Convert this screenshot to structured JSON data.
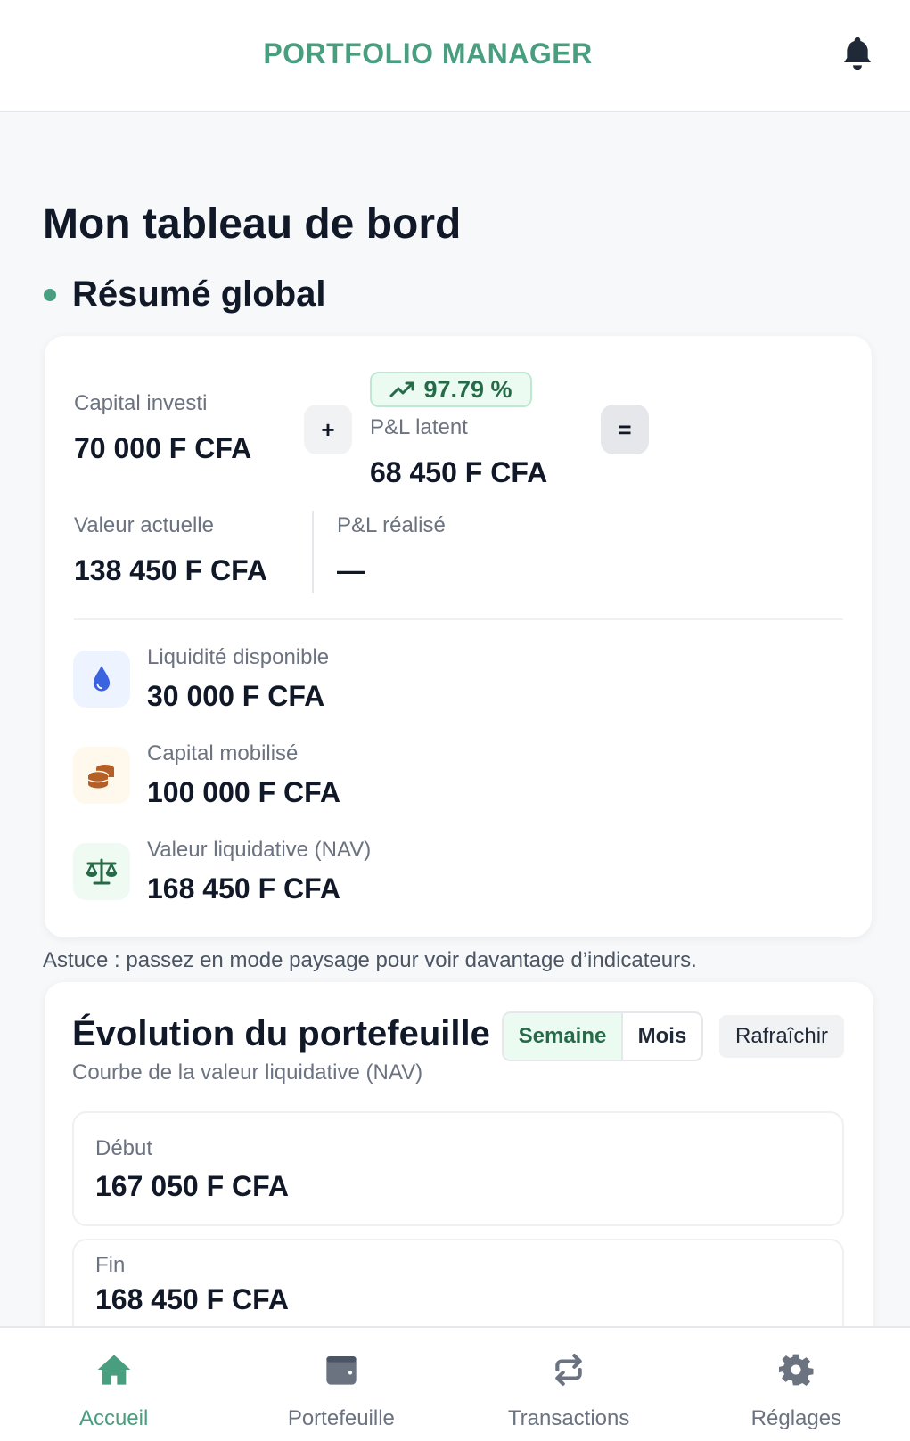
{
  "header": {
    "title": "PORTFOLIO MANAGER",
    "bell_icon": "bell-icon"
  },
  "page_title": "Mon tableau de bord",
  "summary": {
    "title": "Résumé global",
    "capital_investi": {
      "label": "Capital investi",
      "value": "70 000 F CFA"
    },
    "plus": "+",
    "equals": "=",
    "pl_latent": {
      "label": "P&L latent",
      "value": "68 450 F CFA",
      "badge": "97.79 %"
    },
    "valeur_actuelle": {
      "label": "Valeur actuelle",
      "value": "138 450 F CFA"
    },
    "pl_realise": {
      "label": "P&L réalisé",
      "value": "—"
    },
    "items": [
      {
        "label": "Liquidité disponible",
        "value": "30 000 F CFA",
        "icon": "droplet-icon",
        "color": "#3b63e0"
      },
      {
        "label": "Capital mobilisé",
        "value": "100 000 F CFA",
        "icon": "coins-icon",
        "color": "#b45f26"
      },
      {
        "label": "Valeur liquidative (NAV)",
        "value": "168 450 F CFA",
        "icon": "scale-icon",
        "color": "#256b48"
      }
    ]
  },
  "tip": "Astuce : passez en mode paysage pour voir davantage d’indicateurs.",
  "evolution": {
    "title": "Évolution du portefeuille",
    "subtitle": "Courbe de la valeur liquidative (NAV)",
    "tabs": [
      "Semaine",
      "Mois"
    ],
    "active_tab": "Semaine",
    "refresh": "Rafraîchir",
    "start": {
      "label": "Début",
      "value": "167 050 F CFA"
    },
    "end": {
      "label": "Fin",
      "value": "168 450 F CFA"
    }
  },
  "nav": [
    {
      "label": "Accueil",
      "icon": "home-icon",
      "active": true
    },
    {
      "label": "Portefeuille",
      "icon": "wallet-icon"
    },
    {
      "label": "Transactions",
      "icon": "arrows-exchange-icon"
    },
    {
      "label": "Réglages",
      "icon": "gear-icon"
    }
  ],
  "colors": {
    "accent": "#4a9e80",
    "text": "#111827",
    "muted": "#6b7280"
  }
}
